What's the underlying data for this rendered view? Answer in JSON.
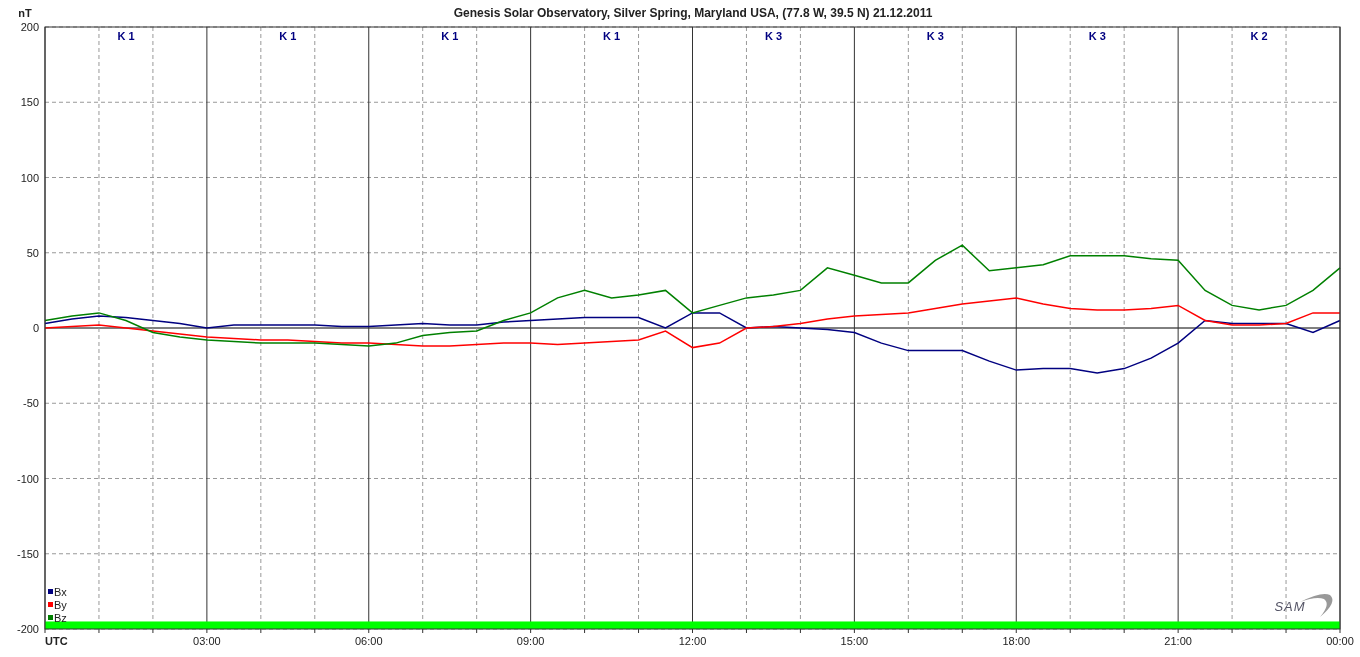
{
  "chart_data": {
    "type": "line",
    "title": "Genesis Solar Observatory, Silver Spring, Maryland USA, (77.8 W, 39.5 N)  21.12.2011",
    "ylabel": "nT",
    "xlim": [
      0,
      24
    ],
    "ylim": [
      -200,
      200
    ],
    "x": [
      0,
      0.5,
      1,
      1.5,
      2,
      2.5,
      3,
      3.5,
      4,
      4.5,
      5,
      5.5,
      6,
      6.5,
      7,
      7.5,
      8,
      8.5,
      9,
      9.5,
      10,
      10.5,
      11,
      11.5,
      12,
      12.5,
      13,
      13.5,
      14,
      14.5,
      15,
      15.5,
      16,
      16.5,
      17,
      17.5,
      18,
      18.5,
      19,
      19.5,
      20,
      20.5,
      21,
      21.5,
      22,
      22.5,
      23,
      23.5,
      24
    ],
    "xticks": [
      {
        "value": 0,
        "label": "UTC"
      },
      {
        "value": 3,
        "label": "03:00"
      },
      {
        "value": 6,
        "label": "06:00"
      },
      {
        "value": 9,
        "label": "09:00"
      },
      {
        "value": 12,
        "label": "12:00"
      },
      {
        "value": 15,
        "label": "15:00"
      },
      {
        "value": 18,
        "label": "18:00"
      },
      {
        "value": 21,
        "label": "21:00"
      },
      {
        "value": 24,
        "label": "00:00"
      }
    ],
    "yticks": [
      -200,
      -150,
      -100,
      -50,
      0,
      50,
      100,
      150,
      200
    ],
    "series": [
      {
        "name": "Bx",
        "color": "#000080",
        "values": [
          3,
          6,
          8,
          7,
          5,
          3,
          0,
          2,
          2,
          2,
          2,
          1,
          1,
          2,
          3,
          2,
          2,
          4,
          5,
          6,
          7,
          7,
          7,
          0,
          10,
          10,
          0,
          1,
          0,
          -1,
          -3,
          -10,
          -15,
          -15,
          -15,
          -22,
          -28,
          -27,
          -27,
          -30,
          -27,
          -20,
          -10,
          5,
          3,
          3,
          3,
          -3,
          5
        ]
      },
      {
        "name": "By",
        "color": "#ff0000",
        "values": [
          0,
          1,
          2,
          0,
          -2,
          -4,
          -6,
          -7,
          -8,
          -8,
          -9,
          -10,
          -10,
          -11,
          -12,
          -12,
          -11,
          -10,
          -10,
          -11,
          -10,
          -9,
          -8,
          -2,
          -13,
          -10,
          0,
          1,
          3,
          6,
          8,
          9,
          10,
          13,
          16,
          18,
          20,
          16,
          13,
          12,
          12,
          13,
          15,
          5,
          2,
          2,
          3,
          10,
          10
        ]
      },
      {
        "name": "Bz",
        "color": "#008000",
        "values": [
          5,
          8,
          10,
          5,
          -3,
          -6,
          -8,
          -9,
          -10,
          -10,
          -10,
          -11,
          -12,
          -10,
          -5,
          -3,
          -2,
          5,
          10,
          20,
          25,
          20,
          22,
          25,
          10,
          15,
          20,
          22,
          25,
          40,
          35,
          30,
          30,
          45,
          55,
          38,
          40,
          42,
          48,
          48,
          48,
          46,
          45,
          25,
          15,
          12,
          15,
          25,
          40
        ]
      }
    ],
    "grid": true,
    "legend": "bottom-left",
    "bands": [
      {
        "axis": "y",
        "from": -200,
        "to": -195,
        "color": "#00ff00"
      }
    ]
  },
  "k_indices": [
    "K 1",
    "K 1",
    "K 1",
    "K 1",
    "K 3",
    "K 3",
    "K 3",
    "K 2"
  ],
  "logo": "SAM"
}
